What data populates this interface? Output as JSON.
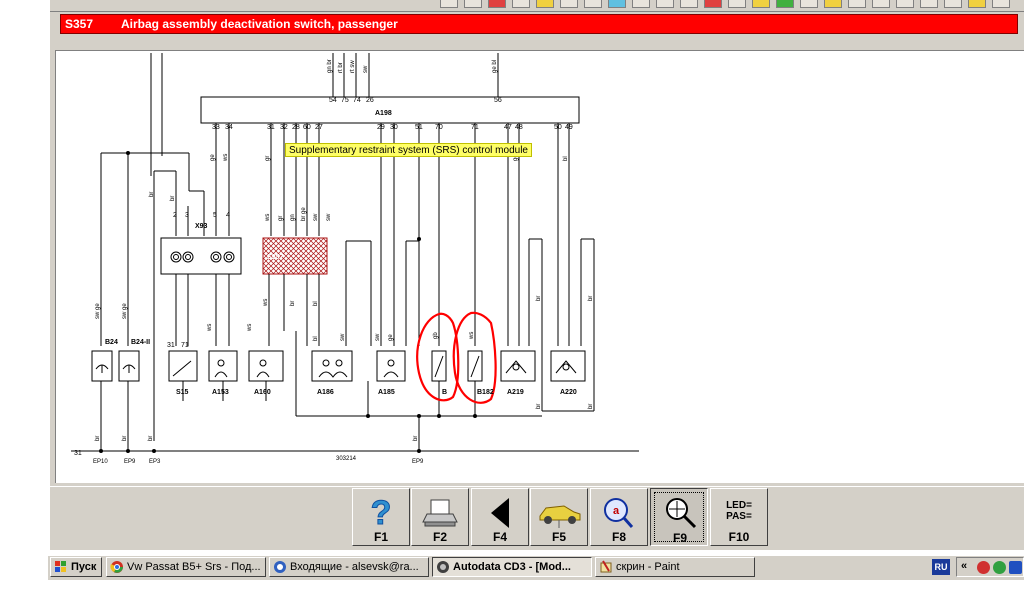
{
  "component": {
    "code": "S357",
    "title": "Airbag assembly deactivation switch, passenger"
  },
  "tooltip": "Supplementary restraint system (SRS) control module",
  "diagram": {
    "module_name": "A198",
    "top_pins": [
      "54",
      "75",
      "74",
      "26",
      "56"
    ],
    "top_wires": [
      "gn br",
      "rt br",
      "rt sw",
      "sw",
      "ge bl"
    ],
    "bottom_pins": [
      "33",
      "34",
      "31",
      "32",
      "28",
      "60",
      "27",
      "29",
      "30",
      "51",
      "70",
      "71",
      "47",
      "48",
      "50",
      "49"
    ],
    "connector_name": "X93",
    "components": [
      "B24",
      "B24-II",
      "S15",
      "A153",
      "A160",
      "A186",
      "A185",
      "B",
      "B182",
      "A219",
      "A220",
      "S357"
    ],
    "ground_points": [
      "EP10",
      "EP9",
      "EP3",
      "EP9"
    ],
    "ground_number": "31",
    "ground_code": "303214",
    "wire_colors": {
      "br": "br",
      "sw_ge": "sw ge",
      "ge": "ge",
      "ws": "ws",
      "gr": "gr",
      "gn": "gn",
      "sw": "sw",
      "bl": "bl",
      "gb": "gb",
      "br_ge": "br ge"
    },
    "connector_pin_labels": [
      "2",
      "3",
      "5",
      "4"
    ],
    "switch_pins": [
      "31",
      "71"
    ]
  },
  "fkeys": [
    {
      "id": "f1",
      "label": "F1",
      "icon": "help-question-icon"
    },
    {
      "id": "f2",
      "label": "F2",
      "icon": "printer-icon"
    },
    {
      "id": "f4",
      "label": "F4",
      "icon": "back-arrow-icon"
    },
    {
      "id": "f5",
      "label": "F5",
      "icon": "car-icon"
    },
    {
      "id": "f8",
      "label": "F8",
      "icon": "search-ata-icon"
    },
    {
      "id": "f9",
      "label": "F9",
      "icon": "zoom-magnifier-icon"
    },
    {
      "id": "f10",
      "label": "F10",
      "icon_text": "LED=\nPAS="
    }
  ],
  "taskbar": {
    "start_label": "Пуск",
    "tasks": [
      {
        "label": "Vw Passat B5+ Srs - Под...",
        "icon": "chrome-icon"
      },
      {
        "label": "Входящие - alsevsk@ra...",
        "icon": "opera-icon"
      },
      {
        "label": "Autodata CD3 - [Mod...",
        "icon": "autodata-icon",
        "active": true
      },
      {
        "label": "скрин - Paint",
        "icon": "paint-icon"
      }
    ],
    "language": "RU",
    "tray_chevron": "«"
  },
  "colors": {
    "caption_bg": "#ff0000",
    "tooltip_bg": "#ffff66",
    "highlight_ring": "#ff0000",
    "hatch": "#aa1111"
  }
}
